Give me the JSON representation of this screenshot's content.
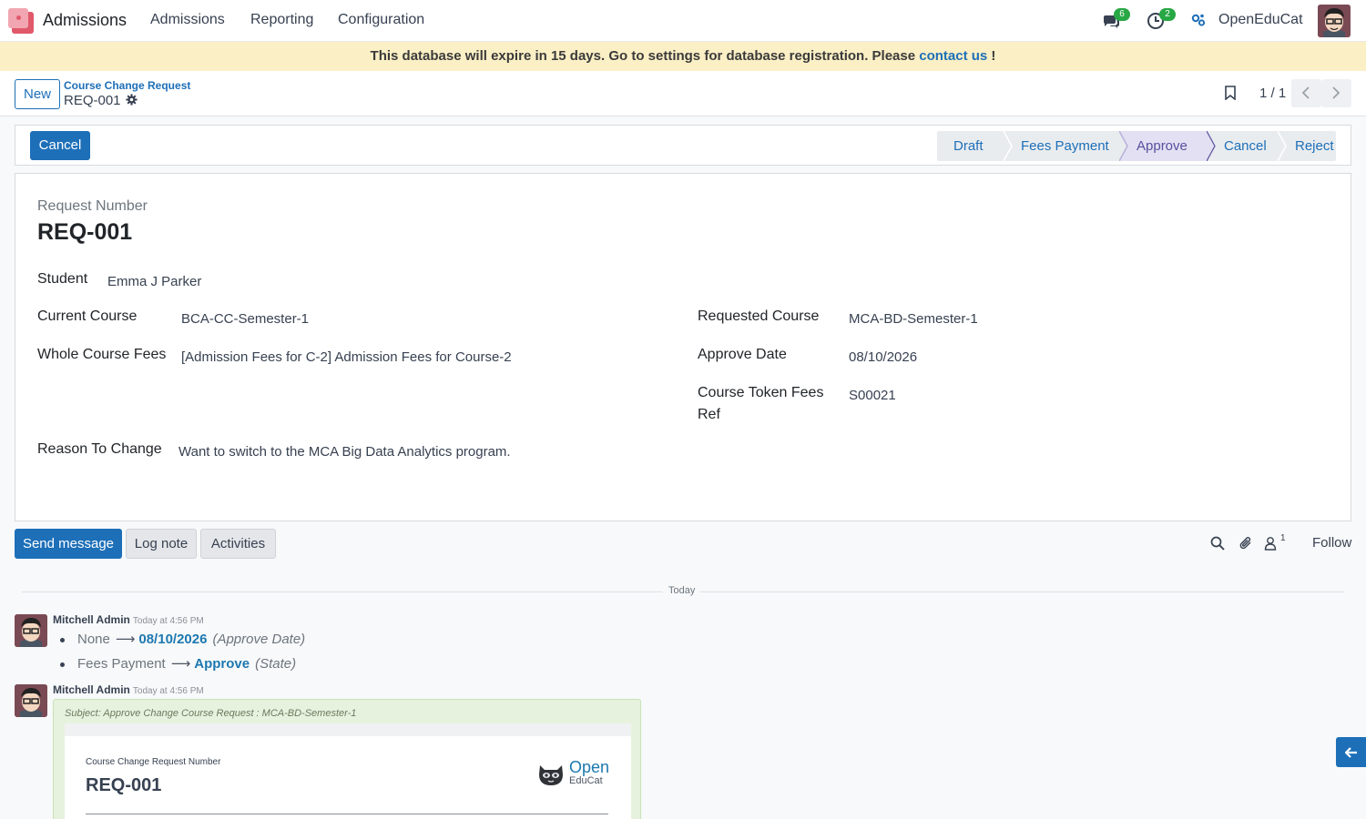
{
  "navbar": {
    "app_name": "Admissions",
    "menu": [
      "Admissions",
      "Reporting",
      "Configuration"
    ],
    "messages_count": "6",
    "activities_count": "2",
    "company": "OpenEduCat"
  },
  "banner": {
    "text": "This database will expire in 15 days. Go to settings for database registration. Please ",
    "link": "contact us",
    "suffix": " !"
  },
  "control": {
    "new_label": "New",
    "breadcrumb_parent": "Course Change Request",
    "breadcrumb_current": "REQ-001",
    "pager": "1 / 1"
  },
  "statusbar": {
    "cancel_label": "Cancel",
    "stages": [
      "Draft",
      "Fees Payment",
      "Approve",
      "Cancel",
      "Reject"
    ],
    "active_stage": "Approve"
  },
  "form": {
    "request_number_label": "Request Number",
    "request_number": "REQ-001",
    "student_label": "Student",
    "student": "Emma J Parker",
    "current_course_label": "Current Course",
    "current_course": "BCA-CC-Semester-1",
    "whole_fees_label": "Whole Course Fees",
    "whole_fees": "[Admission Fees for C-2] Admission Fees for Course-2",
    "requested_course_label": "Requested Course",
    "requested_course": "MCA-BD-Semester-1",
    "approve_date_label": "Approve Date",
    "approve_date": "08/10/2026",
    "token_fees_label_1": "Course Token Fees",
    "token_fees_label_2": "Ref",
    "token_fees": "S00021",
    "reason_label": "Reason To Change",
    "reason": "Want to switch to the MCA Big Data Analytics program."
  },
  "chatter": {
    "send_message": "Send message",
    "log_note": "Log note",
    "activities": "Activities",
    "follower_count": "1",
    "follow": "Follow",
    "date_separator": "Today",
    "messages": [
      {
        "author": "Mitchell Admin",
        "time": "Today at 4:56 PM",
        "changes": [
          {
            "old": "None",
            "new": "08/10/2026",
            "field": "(Approve Date)"
          },
          {
            "old": "Fees Payment",
            "new": "Approve",
            "field": "(State)"
          }
        ]
      },
      {
        "author": "Mitchell Admin",
        "time": "Today at 4:56 PM",
        "subject": "Subject: Approve Change Course Request : MCA-BD-Semester-1",
        "mail_label": "Course Change Request Number",
        "mail_number": "REQ-001",
        "logo_open": "Open",
        "logo_edu": "EduCat"
      }
    ]
  },
  "colors": {
    "primary": "#1d6fb8",
    "active_stage_bg": "#e2e0f2",
    "banner_bg": "#fbefc5",
    "badge": "#28a745"
  }
}
